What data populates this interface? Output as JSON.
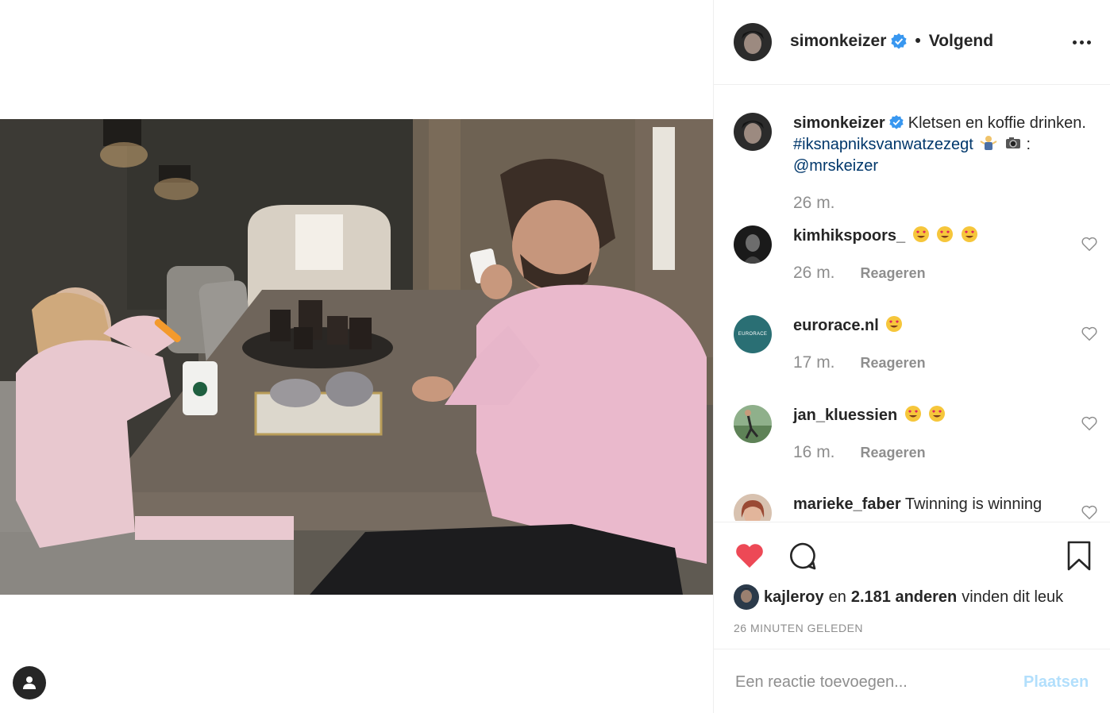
{
  "post": {
    "author": "simonkeizer",
    "follow_dot": "•",
    "follow_label": "Volgend",
    "caption_text": "Kletsen en koffie drinken.",
    "caption_hashtag": "#iksnapniksvanwatzezegt",
    "caption_camera_suffix": ":",
    "caption_mention": "@mrskeizer",
    "caption_time": "26 m."
  },
  "comments": [
    {
      "user": "kimhikspoors_",
      "text": "",
      "emojis": 3,
      "time": "26 m.",
      "reply_label": "Reageren"
    },
    {
      "user": "eurorace.nl",
      "text": "",
      "emojis": 1,
      "time": "17 m.",
      "reply_label": "Reageren",
      "avatar_label": "EURORACE"
    },
    {
      "user": "jan_kluessien",
      "text": "",
      "emojis": 2,
      "time": "16 m.",
      "reply_label": "Reageren"
    },
    {
      "user": "marieke_faber",
      "text": "Twinning is winning",
      "emojis": 0,
      "time": "",
      "reply_label": ""
    }
  ],
  "likes": {
    "first_user": "kajleroy",
    "conj": "en",
    "count_label": "2.181 anderen",
    "suffix": "vinden dit leuk"
  },
  "timestamp": "26 minuten geleden",
  "comment_input": {
    "placeholder": "Een reactie toevoegen...",
    "post_label": "Plaatsen"
  },
  "colors": {
    "liked_heart": "#ed4956",
    "link": "#00376b",
    "verified": "#3897f0",
    "post_disabled": "#b2dffc"
  },
  "icons": [
    "user-tag-icon",
    "verified-icon",
    "more-icon",
    "heart-icon",
    "comment-icon",
    "bookmark-icon",
    "heart-eyes-emoji",
    "shrug-emoji",
    "camera-emoji"
  ]
}
